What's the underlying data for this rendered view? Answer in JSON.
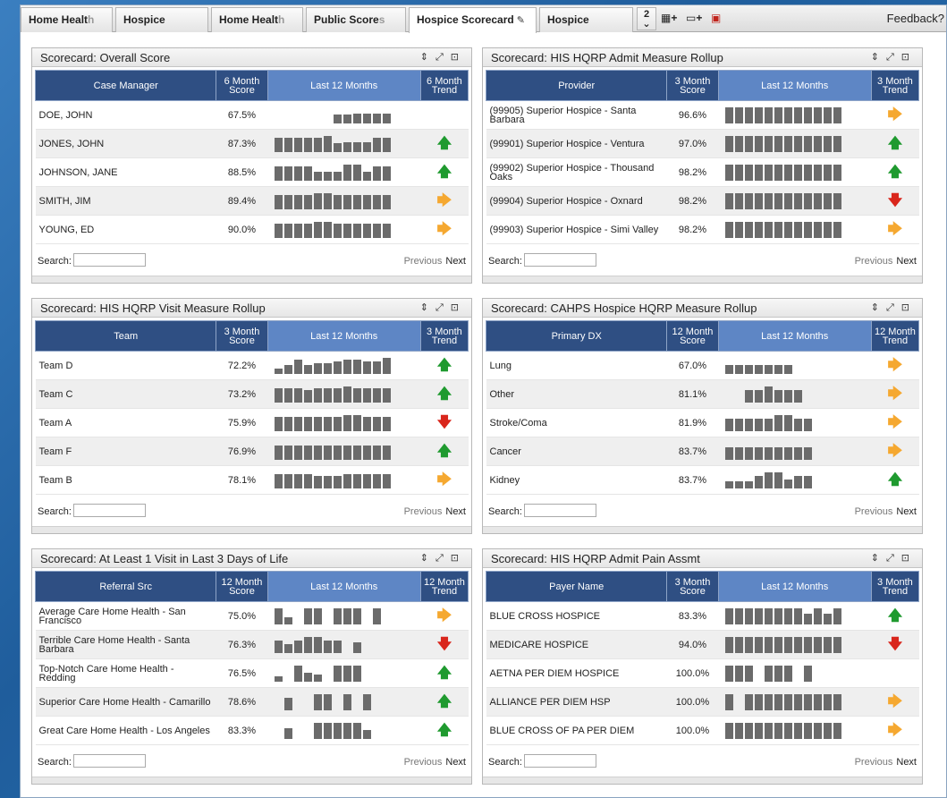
{
  "tabs": [
    {
      "label_a": "Home Healt",
      "label_b": "h",
      "x": 0
    },
    {
      "label": "Hospice"
    },
    {
      "label_a": "Home Healt",
      "label_b": "h"
    },
    {
      "label_a": "Public Score",
      "label_b": "s"
    },
    {
      "label": "Hospice Scorecard"
    },
    {
      "label": "Hospice"
    }
  ],
  "tab_more": {
    "num": "2",
    "caret": "⌄"
  },
  "feedback": "Feedback?",
  "search_label": "Search:",
  "prev_label": "Previous",
  "next_label": "Next",
  "colors": {
    "up": "#1f9a2f",
    "down": "#d9261c",
    "flat": "#f5a830",
    "header": "#2f4f83",
    "header_lm": "#5e86c5",
    "bar": "#6b6b6b"
  },
  "panels": [
    {
      "title": "Scorecard: Overall Score",
      "cols": [
        "Case Manager",
        "6 Month Score",
        "Last 12 Months",
        "6 Month Trend"
      ],
      "rows": [
        {
          "name": "DOE, JOHN",
          "score": "67.5%",
          "trend": "",
          "bars": [
            0,
            0,
            0,
            0,
            0,
            0,
            10,
            10,
            11,
            11,
            11,
            11
          ]
        },
        {
          "name": "JONES, JOHN",
          "score": "87.3%",
          "trend": "up",
          "bars": [
            16,
            16,
            16,
            16,
            16,
            18,
            10,
            11,
            11,
            11,
            16,
            16
          ]
        },
        {
          "name": "JOHNSON, JANE",
          "score": "88.5%",
          "trend": "up",
          "bars": [
            16,
            16,
            16,
            16,
            10,
            10,
            10,
            18,
            18,
            10,
            16,
            16
          ]
        },
        {
          "name": "SMITH, JIM",
          "score": "89.4%",
          "trend": "right",
          "bars": [
            16,
            16,
            16,
            16,
            18,
            18,
            16,
            16,
            16,
            16,
            16,
            16
          ]
        },
        {
          "name": "YOUNG, ED",
          "score": "90.0%",
          "trend": "right",
          "bars": [
            16,
            16,
            16,
            16,
            18,
            18,
            16,
            16,
            16,
            16,
            16,
            16
          ]
        }
      ]
    },
    {
      "title": "Scorecard: HIS HQRP Admit Measure Rollup",
      "cols": [
        "Provider",
        "3 Month Score",
        "Last 12 Months",
        "3 Month Trend"
      ],
      "rows": [
        {
          "name": "(99905) Superior Hospice - Santa Barbara",
          "score": "96.6%",
          "trend": "right",
          "bars": [
            18,
            18,
            18,
            18,
            18,
            18,
            18,
            18,
            18,
            18,
            18,
            18
          ]
        },
        {
          "name": "(99901) Superior Hospice - Ventura",
          "score": "97.0%",
          "trend": "up",
          "bars": [
            18,
            18,
            18,
            18,
            18,
            18,
            18,
            18,
            18,
            18,
            18,
            18
          ]
        },
        {
          "name": "(99902) Superior Hospice - Thousand Oaks",
          "score": "98.2%",
          "trend": "up",
          "bars": [
            18,
            18,
            18,
            18,
            18,
            18,
            18,
            18,
            18,
            18,
            18,
            18
          ]
        },
        {
          "name": "(99904) Superior Hospice - Oxnard",
          "score": "98.2%",
          "trend": "down",
          "bars": [
            18,
            18,
            18,
            18,
            18,
            18,
            18,
            18,
            18,
            18,
            18,
            18
          ]
        },
        {
          "name": "(99903) Superior Hospice - Simi Valley",
          "score": "98.2%",
          "trend": "right",
          "bars": [
            18,
            18,
            18,
            18,
            18,
            18,
            18,
            18,
            18,
            18,
            18,
            18
          ]
        }
      ]
    },
    {
      "title": "Scorecard: HIS HQRP Visit Measure Rollup",
      "cols": [
        "Team",
        "3 Month Score",
        "Last 12 Months",
        "3 Month Trend"
      ],
      "rows": [
        {
          "name": "Team D",
          "score": "72.2%",
          "trend": "up",
          "bars": [
            6,
            10,
            16,
            10,
            12,
            12,
            14,
            16,
            16,
            14,
            14,
            18
          ]
        },
        {
          "name": "Team C",
          "score": "73.2%",
          "trend": "up",
          "bars": [
            16,
            16,
            16,
            14,
            16,
            16,
            16,
            18,
            16,
            16,
            16,
            16
          ]
        },
        {
          "name": "Team A",
          "score": "75.9%",
          "trend": "down",
          "bars": [
            16,
            16,
            16,
            16,
            16,
            16,
            16,
            18,
            18,
            16,
            16,
            16
          ]
        },
        {
          "name": "Team F",
          "score": "76.9%",
          "trend": "up",
          "bars": [
            16,
            16,
            16,
            16,
            16,
            16,
            16,
            16,
            16,
            16,
            16,
            16
          ]
        },
        {
          "name": "Team B",
          "score": "78.1%",
          "trend": "right",
          "bars": [
            16,
            16,
            16,
            16,
            14,
            14,
            14,
            16,
            16,
            16,
            16,
            16
          ]
        }
      ]
    },
    {
      "title": "Scorecard: CAHPS Hospice HQRP Measure Rollup",
      "cols": [
        "Primary DX",
        "12 Month Score",
        "Last 12 Months",
        "12 Month Trend"
      ],
      "rows": [
        {
          "name": "Lung",
          "score": "67.0%",
          "trend": "right",
          "bars": [
            10,
            10,
            10,
            10,
            10,
            10,
            10,
            0,
            0,
            0,
            0,
            0
          ]
        },
        {
          "name": "Other",
          "score": "81.1%",
          "trend": "right",
          "bars": [
            0,
            0,
            14,
            14,
            18,
            14,
            14,
            14,
            0,
            0,
            0,
            0
          ]
        },
        {
          "name": "Stroke/Coma",
          "score": "81.9%",
          "trend": "right",
          "bars": [
            14,
            14,
            14,
            14,
            14,
            18,
            18,
            14,
            14,
            0,
            0,
            0
          ]
        },
        {
          "name": "Cancer",
          "score": "83.7%",
          "trend": "right",
          "bars": [
            14,
            14,
            14,
            14,
            14,
            14,
            14,
            14,
            14,
            0,
            0,
            0
          ]
        },
        {
          "name": "Kidney",
          "score": "83.7%",
          "trend": "up",
          "bars": [
            8,
            8,
            8,
            14,
            18,
            18,
            10,
            14,
            14,
            0,
            0,
            0
          ]
        }
      ]
    },
    {
      "title": "Scorecard: At Least 1 Visit in Last 3 Days of Life",
      "cols": [
        "Referral Src",
        "12 Month Score",
        "Last 12 Months",
        "12 Month Trend"
      ],
      "rows": [
        {
          "name": "Average Care Home Health - San Francisco",
          "score": "75.0%",
          "trend": "right",
          "bars": [
            18,
            8,
            0,
            18,
            18,
            0,
            18,
            18,
            18,
            0,
            18,
            0
          ]
        },
        {
          "name": "Terrible Care Home Health - Santa Barbara",
          "score": "76.3%",
          "trend": "down",
          "bars": [
            14,
            10,
            14,
            18,
            18,
            14,
            14,
            0,
            12,
            0,
            0,
            0
          ]
        },
        {
          "name": "Top-Notch Care Home Health - Redding",
          "score": "76.5%",
          "trend": "up",
          "bars": [
            6,
            0,
            18,
            10,
            8,
            0,
            18,
            18,
            18,
            0,
            0,
            0
          ]
        },
        {
          "name": "Superior Care Home Health - Camarillo",
          "score": "78.6%",
          "trend": "up",
          "bars": [
            0,
            14,
            0,
            0,
            18,
            18,
            0,
            18,
            0,
            18,
            0,
            0
          ]
        },
        {
          "name": "Great Care Home Health - Los Angeles",
          "score": "83.3%",
          "trend": "up",
          "bars": [
            0,
            12,
            0,
            0,
            18,
            18,
            18,
            18,
            18,
            10,
            0,
            0
          ]
        }
      ]
    },
    {
      "title": "Scorecard: HIS HQRP Admit Pain Assmt",
      "cols": [
        "Payer Name",
        "3 Month Score",
        "Last 12 Months",
        "3 Month Trend"
      ],
      "rows": [
        {
          "name": "BLUE CROSS HOSPICE",
          "score": "83.3%",
          "trend": "up",
          "bars": [
            18,
            18,
            18,
            18,
            18,
            18,
            18,
            18,
            12,
            18,
            12,
            18
          ]
        },
        {
          "name": "MEDICARE HOSPICE",
          "score": "94.0%",
          "trend": "down",
          "bars": [
            18,
            18,
            18,
            18,
            18,
            18,
            18,
            18,
            18,
            18,
            18,
            18
          ]
        },
        {
          "name": "AETNA PER DIEM HOSPICE",
          "score": "100.0%",
          "trend": "",
          "bars": [
            18,
            18,
            18,
            0,
            18,
            18,
            18,
            0,
            18,
            0,
            0,
            0
          ]
        },
        {
          "name": "ALLIANCE PER DIEM HSP",
          "score": "100.0%",
          "trend": "right",
          "bars": [
            18,
            0,
            18,
            18,
            18,
            18,
            18,
            18,
            18,
            18,
            18,
            18
          ]
        },
        {
          "name": "BLUE CROSS OF PA PER DIEM",
          "score": "100.0%",
          "trend": "right",
          "bars": [
            18,
            18,
            18,
            18,
            18,
            18,
            18,
            18,
            18,
            18,
            18,
            18
          ]
        }
      ]
    }
  ]
}
